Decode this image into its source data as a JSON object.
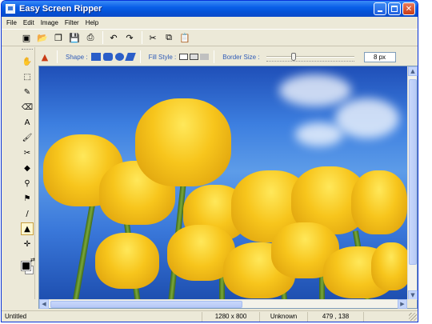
{
  "window": {
    "title": "Easy Screen Ripper"
  },
  "menu": [
    "File",
    "Edit",
    "Image",
    "Filter",
    "Help"
  ],
  "toolbar": {
    "buttons": [
      {
        "name": "capture-icon",
        "glyph": "▣"
      },
      {
        "name": "open-icon",
        "glyph": "📂"
      },
      {
        "name": "copy-doc-icon",
        "glyph": "❐"
      },
      {
        "name": "save-icon",
        "glyph": "💾"
      },
      {
        "name": "print-icon",
        "glyph": "⎙"
      },
      {
        "name": "undo-icon",
        "glyph": "↶"
      },
      {
        "name": "redo-icon",
        "glyph": "↷"
      },
      {
        "name": "cut-icon",
        "glyph": "✂"
      },
      {
        "name": "copy-icon",
        "glyph": "⧉"
      },
      {
        "name": "paste-icon",
        "glyph": "📋"
      }
    ]
  },
  "tools": [
    {
      "name": "hand-tool-icon",
      "glyph": "✋"
    },
    {
      "name": "select-tool-icon",
      "glyph": "⬚"
    },
    {
      "name": "pencil-tool-icon",
      "glyph": "✎"
    },
    {
      "name": "eraser-tool-icon",
      "glyph": "⌫"
    },
    {
      "name": "text-tool-icon",
      "glyph": "A"
    },
    {
      "name": "brush-tool-icon",
      "glyph": "🖌"
    },
    {
      "name": "crop-tool-icon",
      "glyph": "✂"
    },
    {
      "name": "fill-tool-icon",
      "glyph": "◆"
    },
    {
      "name": "eyedropper-tool-icon",
      "glyph": "⚲"
    },
    {
      "name": "stamp-tool-icon",
      "glyph": "⚑"
    },
    {
      "name": "line-tool-icon",
      "glyph": "/"
    },
    {
      "name": "shape-tool-icon",
      "glyph": "▲"
    },
    {
      "name": "move-tool-icon",
      "glyph": "✛"
    }
  ],
  "options": {
    "shape_label": "Shape :",
    "fill_label": "Fill Style :",
    "border_label": "Border Size :",
    "border_value": "8 px",
    "border_level": 0.3
  },
  "status": {
    "filename": "Untitled",
    "dimensions": "1280 x 800",
    "format": "Unknown",
    "coords": "479 , 138"
  },
  "colors": {
    "foreground": "#000000",
    "background": "#ffffff",
    "titlebar": "#0a5fe8",
    "accent": "#2f5bb7"
  }
}
